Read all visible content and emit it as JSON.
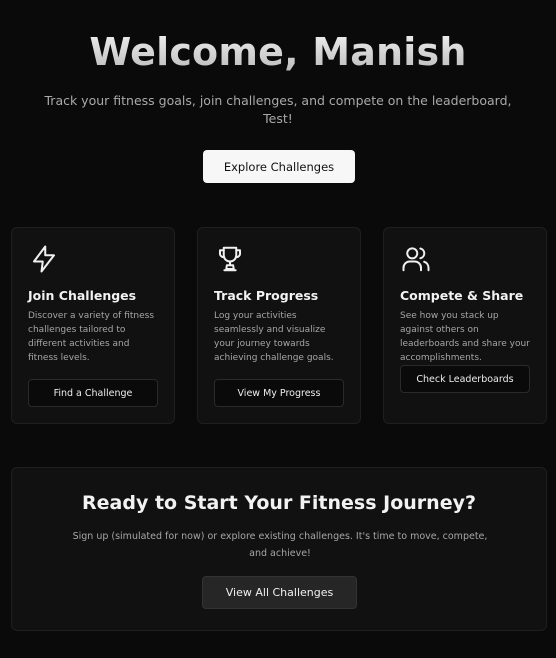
{
  "hero": {
    "title": "Welcome, Manish",
    "subtitle": "Track your fitness goals, join challenges, and compete on the leaderboard, Test!",
    "button_label": "Explore Challenges"
  },
  "features": [
    {
      "icon": "lightning-bolt-icon",
      "title": "Join Challenges",
      "description": "Discover a variety of fitness challenges tailored to different activities and fitness levels.",
      "button_label": "Find a Challenge"
    },
    {
      "icon": "trophy-icon",
      "title": "Track Progress",
      "description": "Log your activities seamlessly and visualize your journey towards achieving challenge goals.",
      "button_label": "View My Progress"
    },
    {
      "icon": "users-icon",
      "title": "Compete & Share",
      "description": "See how you stack up against others on leaderboards and share your accomplishments.",
      "button_label": "Check Leaderboards"
    }
  ],
  "cta": {
    "title": "Ready to Start Your Fitness Journey?",
    "subtitle": "Sign up (simulated for now) or explore existing challenges. It's time to move, compete, and achieve!",
    "button_label": "View All Challenges"
  },
  "colors": {
    "background": "#0a0a0a",
    "card_background": "#111111",
    "primary_button": "#f7f7f7",
    "secondary_button": "#262626"
  }
}
